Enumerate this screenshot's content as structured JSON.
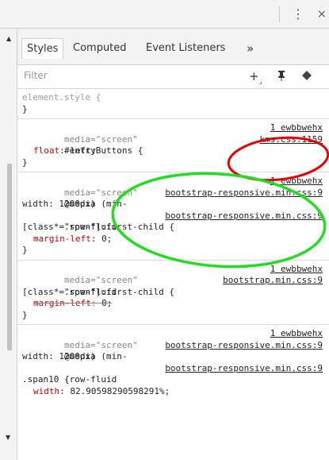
{
  "toolbar": {
    "kebab": "⋮",
    "close": "×"
  },
  "tabs": [
    {
      "label": "Styles",
      "active": true
    },
    {
      "label": "Computed",
      "active": false
    },
    {
      "label": "Event Listeners",
      "active": false
    },
    {
      "label": "»",
      "active": false
    }
  ],
  "filter": {
    "placeholder": "Filter",
    "add": "+",
    "pin": "🖈",
    "toggle": "◆"
  },
  "rules": {
    "element_style": {
      "selector": "element.style {",
      "close": "}"
    },
    "r1": {
      "media": "media=\"screen\"",
      "src1": "1 ewbbwehx",
      "selector": "#entryButtons {",
      "src2": "kms.css:1159",
      "prop_name": "float",
      "prop_value": "left;",
      "close": "}"
    },
    "r2": {
      "media": "media=\"screen\"",
      "src1": "1 ewbbwehx",
      "at1": "@media (min-",
      "src2": "bootstrap-responsive.min.css:9",
      "at2": "width: 1200px)",
      "sel1": ".row-fluid",
      "src3": "bootstrap-responsive.min.css:9",
      "sel2": "[class*=\"span\"]:first-child {",
      "prop_name": "margin-left",
      "prop_value": "0;",
      "close": "}"
    },
    "r3": {
      "media": "media=\"screen\"",
      "src1": "1 ewbbwehx",
      "sel1": ".row-fluid",
      "src2": "bootstrap.min.css:9",
      "sel2": "[class*=\"span\"]:first-child {",
      "prop_name": "margin-left",
      "prop_value": "0;",
      "close": "}"
    },
    "r4": {
      "media": "media=\"screen\"",
      "src1": "1 ewbbwehx",
      "at1": "@media (min-",
      "src2": "bootstrap-responsive.min.css:9",
      "at2": "width: 1200px)",
      "sel1": ".row-fluid",
      "src3": "bootstrap-responsive.min.css:9",
      "sel2": ".span10 {",
      "prop_name": "width",
      "prop_value": "82.90598290598291%;"
    }
  },
  "annotations": {
    "red_color": "#e60000",
    "green_color": "#22dd22"
  }
}
